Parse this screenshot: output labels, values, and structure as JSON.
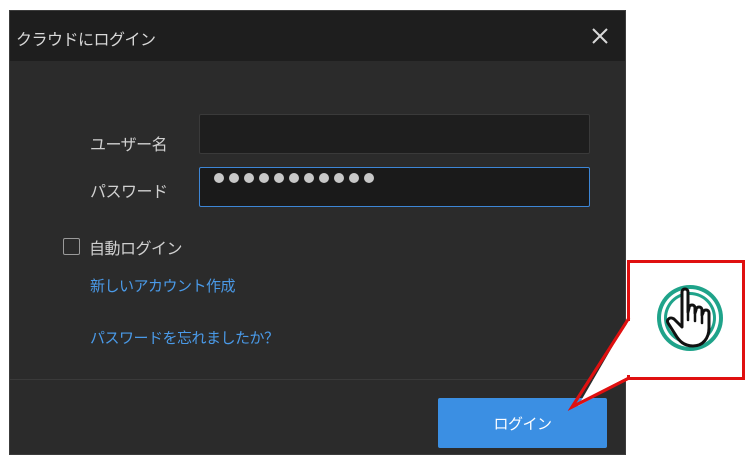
{
  "dialog": {
    "title": "クラウドにログイン",
    "close_glyph": "✕"
  },
  "form": {
    "username_label": "ユーザー名",
    "username_value": "",
    "password_label": "パスワード",
    "password_masked_count": 11,
    "auto_login_label": "自動ログイン",
    "auto_login_checked": false
  },
  "links": {
    "create_account": "新しいアカウント作成",
    "forgot_password": "パスワードを忘れましたか？"
  },
  "actions": {
    "login_label": "ログイン"
  },
  "colors": {
    "accent": "#3b8fe3",
    "link": "#4a9ae8",
    "callout": "#e01010",
    "hand_ring": "#1fa38a"
  },
  "annotation": {
    "icon": "tap-hand-icon"
  }
}
